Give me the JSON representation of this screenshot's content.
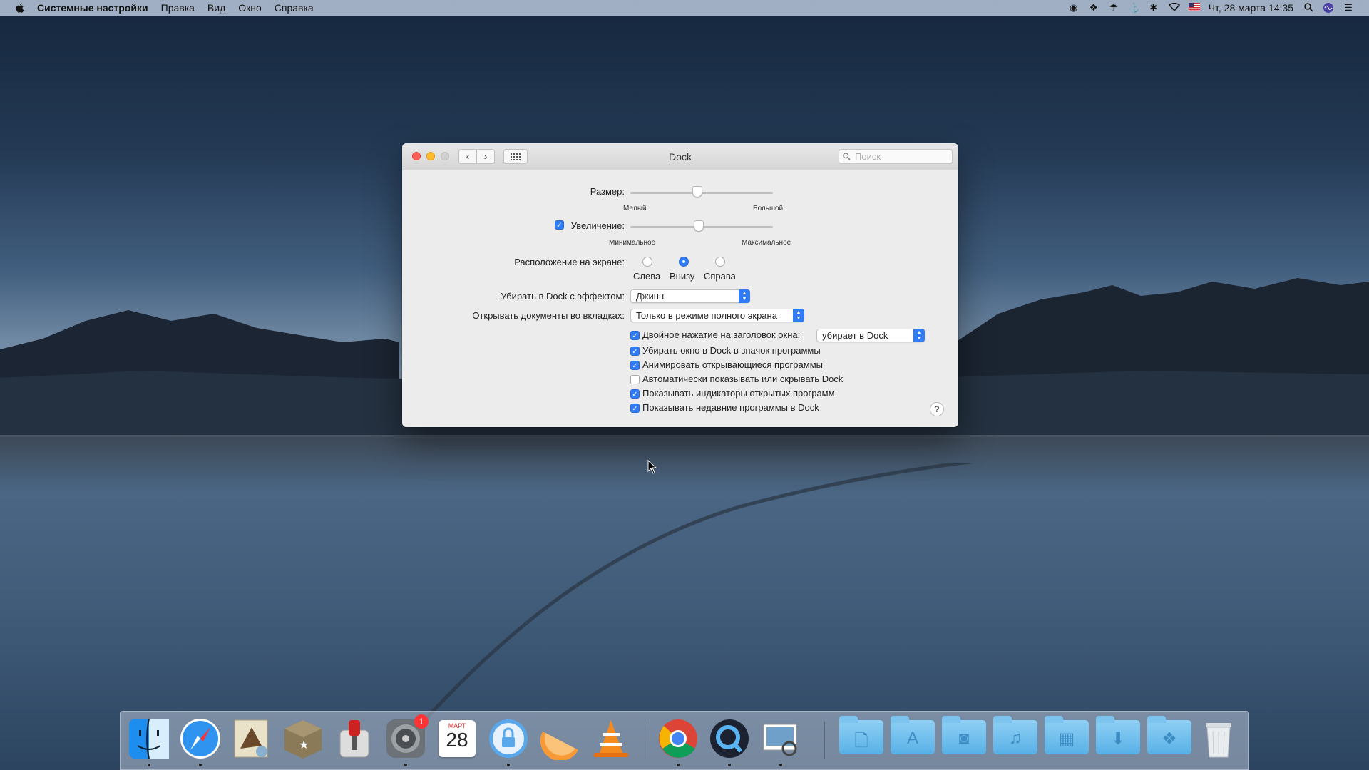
{
  "menubar": {
    "app_name": "Системные настройки",
    "items": [
      "Правка",
      "Вид",
      "Окно",
      "Справка"
    ],
    "datetime": "Чт, 28 марта  14:35",
    "status_icons": [
      "record-icon",
      "dropbox-icon",
      "umbrella-icon",
      "anchor-icon",
      "bluetooth-icon",
      "wifi-icon",
      "flag-us-icon",
      "search-icon",
      "siri-icon",
      "notification-center-icon"
    ]
  },
  "window": {
    "title": "Dock",
    "search_placeholder": "Поиск",
    "size": {
      "label": "Размер:",
      "min_label": "Малый",
      "max_label": "Большой",
      "value": 0.47
    },
    "magnification": {
      "label": "Увеличение:",
      "checked": true,
      "min_label": "Минимальное",
      "max_label": "Максимальное",
      "value": 0.48
    },
    "position": {
      "label": "Расположение на экране:",
      "options": [
        "Слева",
        "Внизу",
        "Справа"
      ],
      "selected": "Внизу"
    },
    "minimize_effect": {
      "label": "Убирать в Dock с эффектом:",
      "value": "Джинн"
    },
    "open_tabs": {
      "label": "Открывать документы во вкладках:",
      "value": "Только в режиме полного экрана"
    },
    "checkboxes": [
      {
        "label": "Двойное нажатие на заголовок окна:",
        "checked": true,
        "popup": "убирает в Dock"
      },
      {
        "label": "Убирать окно в Dock в значок программы",
        "checked": true
      },
      {
        "label": "Анимировать открывающиеся программы",
        "checked": true
      },
      {
        "label": "Автоматически показывать или скрывать Dock",
        "checked": false
      },
      {
        "label": "Показывать индикаторы открытых программ",
        "checked": true
      },
      {
        "label": "Показывать недавние программы в Dock",
        "checked": true
      }
    ],
    "help": "?"
  },
  "dock": {
    "calendar_month": "МАРТ",
    "calendar_day": "28",
    "prefs_badge": "1",
    "apps": [
      "finder",
      "safari",
      "mail-eagle",
      "box",
      "transmission",
      "system-preferences",
      "calendar",
      "lock",
      "orange",
      "vlc",
      "chrome",
      "quicktime",
      "preview"
    ],
    "folders": [
      "documents-folder",
      "applications-folder",
      "photos-folder",
      "music-folder",
      "movies-folder",
      "downloads-folder",
      "dropbox-folder"
    ]
  }
}
